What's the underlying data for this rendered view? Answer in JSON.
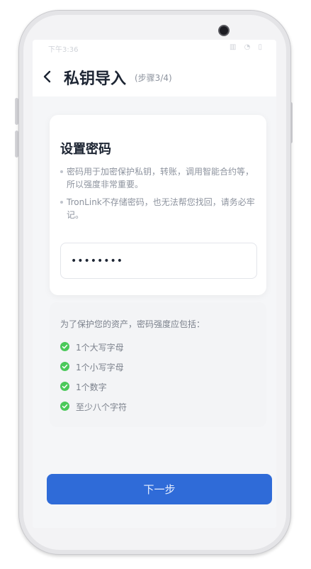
{
  "statusbar": {
    "time": "下午3:36",
    "icons": "▥ ◔ ▯"
  },
  "header": {
    "title": "私钥导入",
    "step": "(步骤3/4)"
  },
  "card": {
    "title": "设置密码",
    "tips": [
      "密码用于加密保护私钥，转账，调用智能合约等，所以强度非常重要。",
      "TronLink不存储密码，也无法帮您找回，请务必牢记。"
    ],
    "password_value": "********"
  },
  "requirements": {
    "title": "为了保护您的资产，密码强度应包括：",
    "items": [
      "1个大写字母",
      "1个小写字母",
      "1个数字",
      "至少八个字符"
    ]
  },
  "footer": {
    "next_label": "下一步"
  },
  "colors": {
    "accent": "#2f6bd8",
    "check": "#4bc95a"
  }
}
